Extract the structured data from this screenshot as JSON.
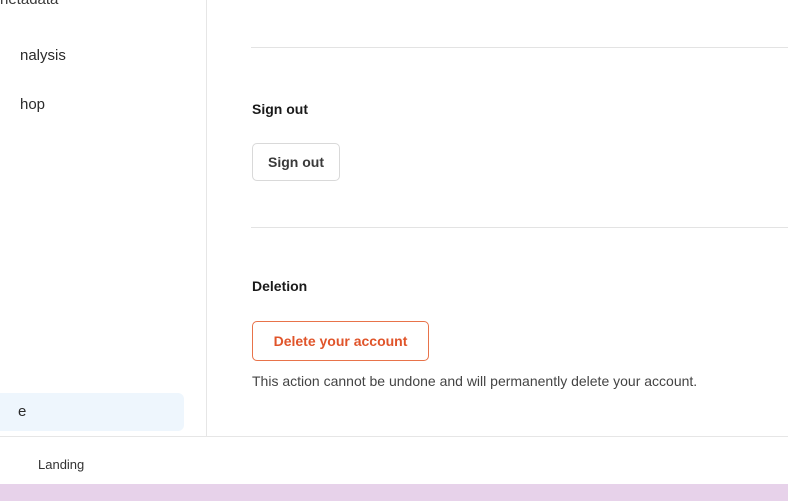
{
  "sidebar": {
    "items": [
      {
        "label": "netadata"
      },
      {
        "label": "nalysis"
      },
      {
        "label": "hop"
      },
      {
        "label": "e"
      }
    ]
  },
  "main": {
    "sign_out": {
      "title": "Sign out",
      "button_label": "Sign out"
    },
    "deletion": {
      "title": "Deletion",
      "button_label": "Delete your account",
      "note": "This action cannot be undone and will permanently delete your account."
    }
  },
  "footer": {
    "label": "Landing"
  },
  "colors": {
    "danger": "#e0542a",
    "active_bg": "#eef6fd",
    "bottom_band": "#e7d2ea"
  }
}
